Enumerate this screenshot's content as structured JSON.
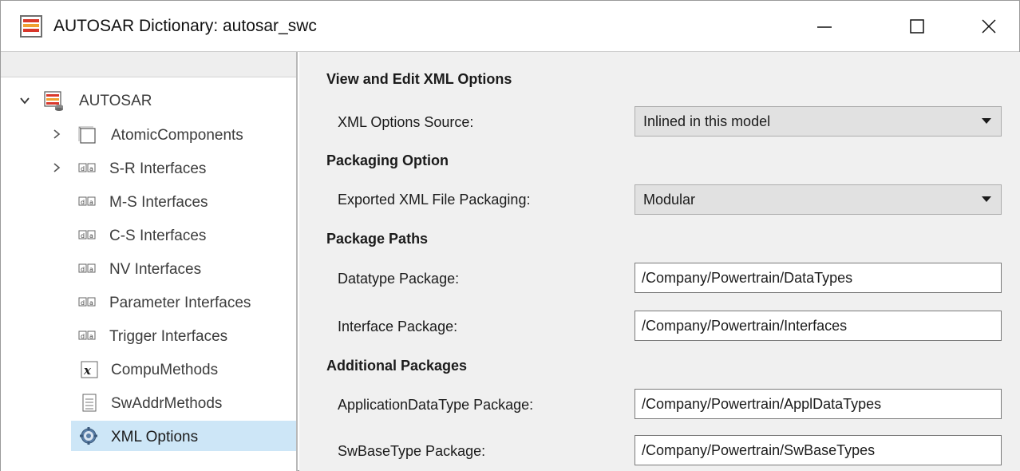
{
  "window": {
    "title": "AUTOSAR Dictionary: autosar_swc",
    "minimize_glyph": "—",
    "maximize_glyph": "☐",
    "close_glyph": "✕"
  },
  "tree": {
    "root": {
      "label": "AUTOSAR",
      "icon": "autosar-db-icon",
      "expanded": true
    },
    "items": [
      {
        "label": "AtomicComponents",
        "icon": "component-icon",
        "expandable": true
      },
      {
        "label": "S-R Interfaces",
        "icon": "interface-icon",
        "expandable": true
      },
      {
        "label": "M-S Interfaces",
        "icon": "interface-icon",
        "expandable": false
      },
      {
        "label": "C-S Interfaces",
        "icon": "interface-icon",
        "expandable": false
      },
      {
        "label": "NV Interfaces",
        "icon": "interface-icon",
        "expandable": false
      },
      {
        "label": "Parameter Interfaces",
        "icon": "interface-icon",
        "expandable": false
      },
      {
        "label": "Trigger Interfaces",
        "icon": "interface-icon",
        "expandable": false
      },
      {
        "label": "CompuMethods",
        "icon": "function-x-icon",
        "expandable": false
      },
      {
        "label": "SwAddrMethods",
        "icon": "document-list-icon",
        "expandable": false
      },
      {
        "label": "XML Options",
        "icon": "gear-icon",
        "expandable": false,
        "selected": true
      }
    ]
  },
  "content": {
    "view_edit_title": "View and Edit XML Options",
    "xml_options_source": {
      "label": "XML Options Source:",
      "value": "Inlined in this model"
    },
    "packaging_title": "Packaging Option",
    "exported_packaging": {
      "label": "Exported XML File Packaging:",
      "value": "Modular"
    },
    "package_paths_title": "Package Paths",
    "datatype_package": {
      "label": "Datatype Package:",
      "value": "/Company/Powertrain/DataTypes"
    },
    "interface_package": {
      "label": "Interface Package:",
      "value": "/Company/Powertrain/Interfaces"
    },
    "additional_title": "Additional Packages",
    "appl_datatype_package": {
      "label": "ApplicationDataType Package:",
      "value": "/Company/Powertrain/ApplDataTypes"
    },
    "swbasetype_package": {
      "label": "SwBaseType Package:",
      "value": "/Company/Powertrain/SwBaseTypes"
    }
  },
  "colors": {
    "selection": "#cde6f7",
    "panel_bg": "#f0f0f0",
    "app_icon_red": "#d9382c",
    "app_icon_orange": "#f0a030"
  }
}
